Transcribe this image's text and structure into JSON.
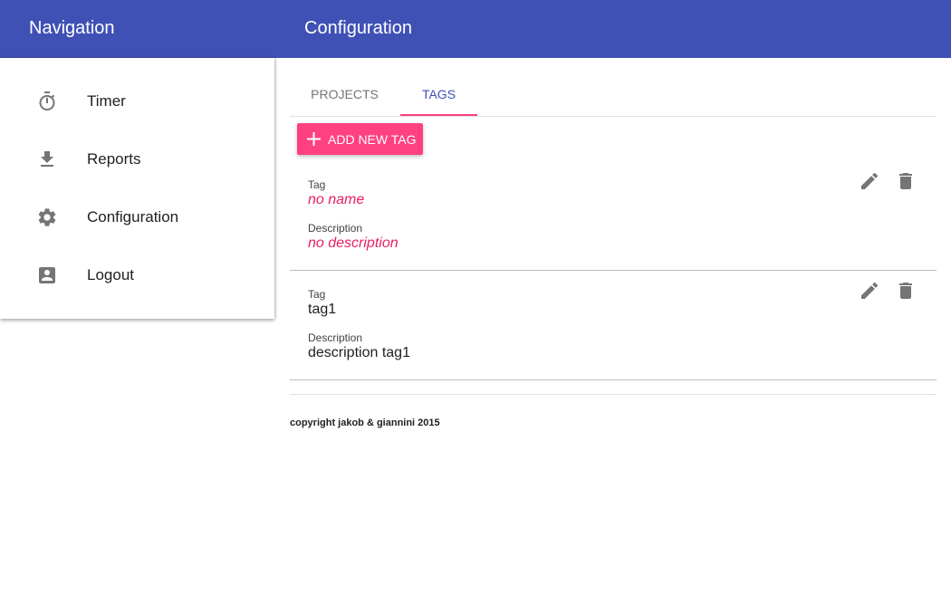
{
  "header": {
    "nav_title": "Navigation",
    "page_title": "Configuration",
    "color": "#3f51b5"
  },
  "sidebar": {
    "items": [
      {
        "label": "Timer",
        "icon": "timer-icon"
      },
      {
        "label": "Reports",
        "icon": "download-icon"
      },
      {
        "label": "Configuration",
        "icon": "gear-icon"
      },
      {
        "label": "Logout",
        "icon": "account-box-icon"
      }
    ]
  },
  "tabs": [
    {
      "label": "PROJECTS",
      "active": false
    },
    {
      "label": "TAGS",
      "active": true
    }
  ],
  "add_button": {
    "label": "ADD NEW TAG",
    "color": "#ff4081"
  },
  "tags": [
    {
      "tag_label": "Tag",
      "tag_value": "no name",
      "desc_label": "Description",
      "desc_value": "no description",
      "empty": true
    },
    {
      "tag_label": "Tag",
      "tag_value": "tag1",
      "desc_label": "Description",
      "desc_value": "description tag1",
      "empty": false
    }
  ],
  "footer": {
    "text": "copyright jakob & giannini 2015"
  },
  "colors": {
    "accent": "#ff4081",
    "primary": "#3f51b5",
    "empty_value": "#e91e63",
    "icon": "#757575"
  }
}
